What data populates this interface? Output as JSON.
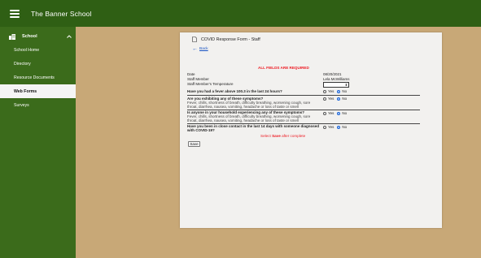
{
  "app": {
    "title": "The Banner School"
  },
  "sidebar": {
    "section_label": "School",
    "items": [
      {
        "label": "School Home"
      },
      {
        "label": "Directory"
      },
      {
        "label": "Resource Documents"
      },
      {
        "label": "Web Forms",
        "active": true
      },
      {
        "label": "Surveys"
      }
    ]
  },
  "form": {
    "title": "COVID Response Form - Staff",
    "back_label": "Back",
    "required_notice": "ALL FIELDS ARE REQUIRED",
    "date_label": "Date",
    "date_value": "08/20/2021",
    "staff_label": "Staff Member",
    "staff_value": "Lela McWilliams",
    "temp_label": "Staff Member's Temperature",
    "temp_value": "",
    "q1": {
      "label": "Have you had a fever above 100.3 in the last 24 hours?",
      "yes": "Yes",
      "no": "No",
      "selected": "No"
    },
    "q2": {
      "label": "Are you exhibiting any of these symptoms?",
      "sub1": "Fever, chills, shortness of breath, difficulty breathing, worsening cough, sore",
      "sub2": "throat, diarrhea, nausea, vomiting, headache or loss of taste or smell",
      "yes": "Yes",
      "no": "No",
      "selected": "No"
    },
    "q3": {
      "label": "Is anyone in your household experiencing any of these symptoms?",
      "sub1": "Fever, chills, shortness of breath, difficulty breathing, worsening cough, sore",
      "sub2": "throat, diarrhea, nausea, vomiting, headache or loss of taste or smell",
      "yes": "Yes",
      "no": "No",
      "selected": "No"
    },
    "q4": {
      "label1": "Have you been in close contact in the last 14 days with someone diagnosed",
      "label2": "with COVID-19?",
      "yes": "Yes",
      "no": "No",
      "selected": "No"
    },
    "select_msg_pre": "Select",
    "select_msg_em": "Save",
    "select_msg_post": "after complete",
    "save_label": "Save"
  },
  "colors": {
    "topbar": "#2f5f14",
    "sidebar": "#3b6b1b",
    "background": "#c8a877",
    "required": "#ee1c24",
    "link": "#1a55c4",
    "radio_selected": "#1a63d6"
  },
  "icons": {
    "menu": "hamburger-menu-icon",
    "school": "school-building-icon",
    "collapse": "chevron-up-icon",
    "form": "document-icon",
    "back": "arrow-left-icon"
  }
}
